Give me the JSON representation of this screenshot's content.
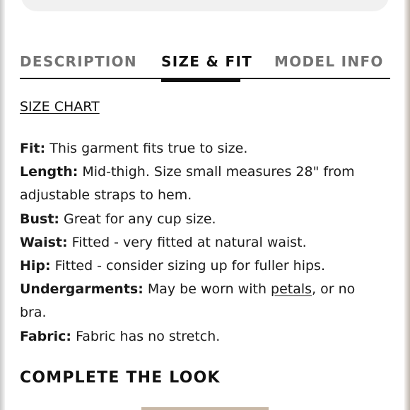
{
  "tabs": [
    {
      "label": "DESCRIPTION",
      "active": false
    },
    {
      "label": "SIZE & FIT",
      "active": true
    },
    {
      "label": "MODEL INFO",
      "active": false
    }
  ],
  "size_chart_link": "SIZE CHART",
  "details": {
    "fit": {
      "label": "Fit:",
      "text": " This garment fits true to size."
    },
    "length": {
      "label": "Length:",
      "text": " Mid-thigh. Size small measures 28\" from adjustable straps to hem."
    },
    "bust": {
      "label": "Bust:",
      "text": " Great for any cup size."
    },
    "waist": {
      "label": "Waist:",
      "text": " Fitted - very fitted at natural waist."
    },
    "hip": {
      "label": "Hip:",
      "text": " Fitted - consider sizing up for fuller hips."
    },
    "undergarments": {
      "label": "Undergarments:",
      "text_before": " May be worn with ",
      "link": "petals",
      "text_after": ", or no bra."
    },
    "fabric": {
      "label": "Fabric:",
      "text": " Fabric has no stretch."
    }
  },
  "complete_the_look": "COMPLETE THE LOOK",
  "colors": {
    "active_tab": "#111111",
    "inactive_tab": "#737373",
    "text": "#1a1a1a"
  }
}
